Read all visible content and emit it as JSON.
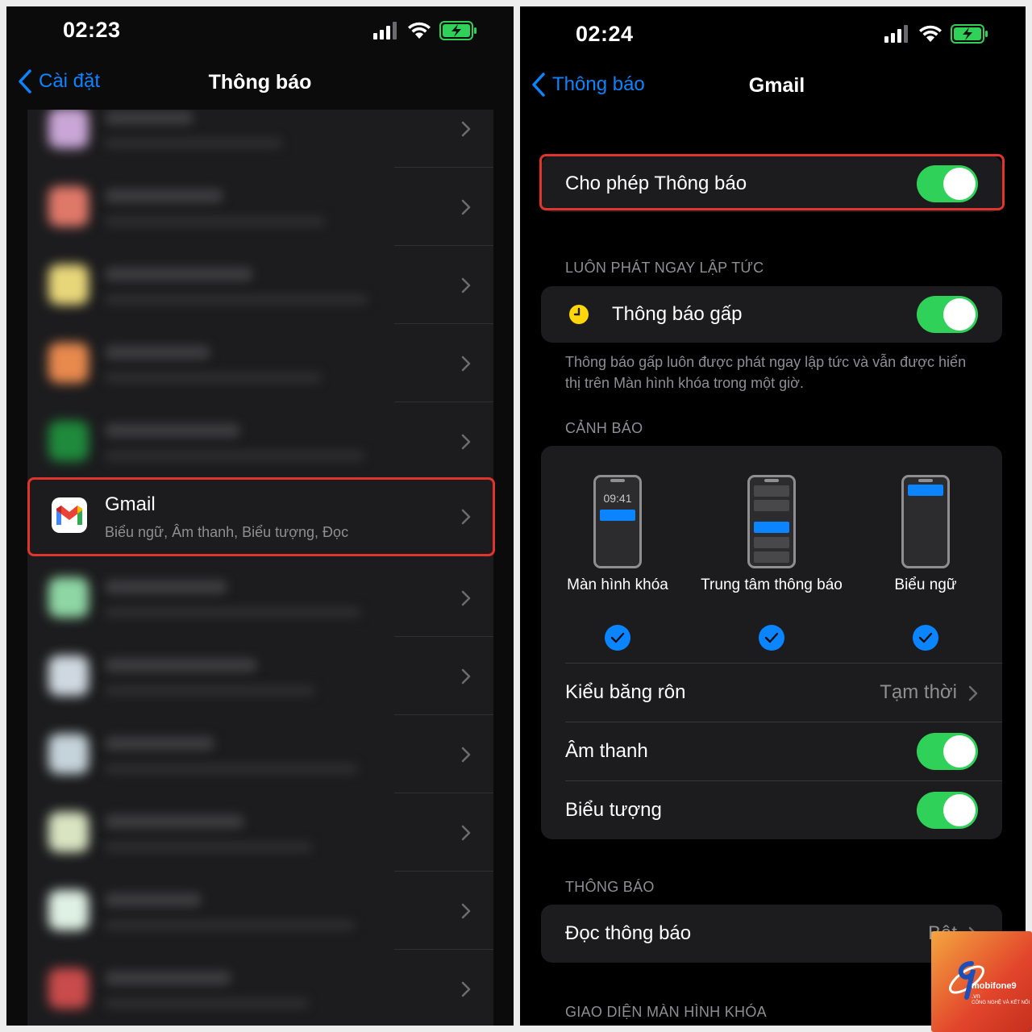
{
  "left": {
    "status_time": "02:23",
    "nav_back": "Cài đặt",
    "nav_title": "Thông báo",
    "gmail": {
      "name": "Gmail",
      "subtitle": "Biểu ngữ, Âm thanh, Biểu tượng, Đọc"
    },
    "blurred_colors": [
      "#c9a6d6",
      "#e0786a",
      "#e8d77a",
      "#e8894e",
      "#1f8a3c",
      "#8ed6a4",
      "#cfd8e0",
      "#c5d3da",
      "#d9e4c2",
      "#dff0e4",
      "#c94b4b"
    ]
  },
  "right": {
    "status_time": "02:24",
    "nav_back": "Thông báo",
    "nav_title": "Gmail",
    "allow_notifications": {
      "label": "Cho phép Thông báo",
      "on": true
    },
    "always_deliver_header": "LUÔN PHÁT NGAY LẬP TỨC",
    "time_sensitive": {
      "label": "Thông báo gấp",
      "on": true
    },
    "time_sensitive_note": "Thông báo gấp luôn được phát ngay lập tức và vẫn được hiển thị trên Màn hình khóa trong một giờ.",
    "alerts_header": "CẢNH BÁO",
    "alert_options": [
      {
        "label": "Màn hình khóa",
        "mini_time": "09:41",
        "checked": true
      },
      {
        "label": "Trung tâm thông báo",
        "checked": true
      },
      {
        "label": "Biểu ngữ",
        "checked": true
      }
    ],
    "banner_style": {
      "label": "Kiểu băng rôn",
      "value": "Tạm thời"
    },
    "sounds": {
      "label": "Âm thanh",
      "on": true
    },
    "badges": {
      "label": "Biểu tượng",
      "on": true
    },
    "announce_header": "THÔNG BÁO",
    "announce": {
      "label": "Đọc thông báo",
      "value": "Bật"
    },
    "lockscreen_header": "GIAO DIỆN MÀN HÌNH KHÓA"
  },
  "watermark": {
    "brand": "mobifone9",
    "domain": ".vn",
    "tagline": "CÔNG NGHỆ VÀ KẾT NỐI"
  },
  "colors": {
    "accent": "#0a84ff",
    "toggle_on": "#30d158",
    "highlight": "#e0342c"
  }
}
